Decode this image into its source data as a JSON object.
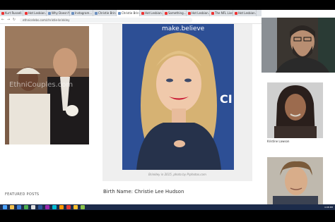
{
  "tabs": [
    {
      "label": "Kurt Russell..."
    },
    {
      "label": "Hot Lesbian..."
    },
    {
      "label": "Why Doesn't..."
    },
    {
      "label": "Instagram..."
    },
    {
      "label": "Christie Brin..."
    },
    {
      "label": "Christie Brin..."
    },
    {
      "label": "Hot Lesbian..."
    },
    {
      "label": "Something..."
    },
    {
      "label": "Hot Lesbian..."
    },
    {
      "label": "The NFL Live..."
    },
    {
      "label": "Hot Lesbian..."
    }
  ],
  "address_bar": {
    "url": "ethnicelebs.com/christie-brinkley"
  },
  "left_photo": {
    "watermark": "EthniCouples.com"
  },
  "featured": {
    "label": "FEATURED POSTS"
  },
  "main_photo": {
    "backdrop_text": "make.believe",
    "backdrop_side": "CI"
  },
  "caption": {
    "text": "Brinkley in 2015, photo by Prphotos.com"
  },
  "birth": {
    "text": "Birth Name: Christie Lee Hudson"
  },
  "sidebar": {
    "person1_label": "Kristine Lawson"
  },
  "taskbar": {
    "clock": "4:08 PM"
  },
  "colors": {
    "main_backdrop": "#2d4f95",
    "taskbar": "#1c2b4a",
    "card": "#efefef"
  }
}
